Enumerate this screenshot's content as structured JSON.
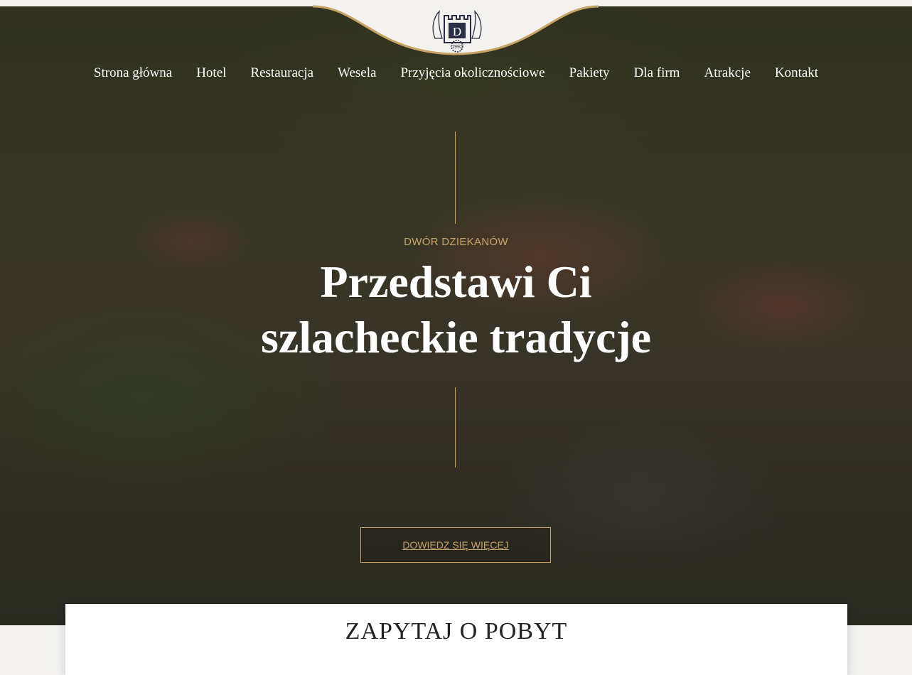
{
  "logo": {
    "letter": "D",
    "year": "1992",
    "icon": "castle-tower-logo-icon"
  },
  "nav": {
    "items": [
      {
        "label": "Strona główna"
      },
      {
        "label": "Hotel"
      },
      {
        "label": "Restauracja"
      },
      {
        "label": "Wesela"
      },
      {
        "label": "Przyjęcia okolicznościowe"
      },
      {
        "label": "Pakiety"
      },
      {
        "label": "Dla firm"
      },
      {
        "label": "Atrakcje"
      },
      {
        "label": "Kontakt"
      }
    ]
  },
  "hero": {
    "eyebrow": "DWÓR DZIEKANÓW",
    "headline_line1": "Przedstawi Ci",
    "headline_line2": "szlacheckie tradycje",
    "cta_label": "DOWIEDZ SIĘ WIĘCEJ"
  },
  "inquiry": {
    "title": "ZAPYTAJ O POBYT"
  },
  "colors": {
    "accent_gold": "#c9a366",
    "nav_text": "#ffffff",
    "card_bg": "#ffffff"
  }
}
